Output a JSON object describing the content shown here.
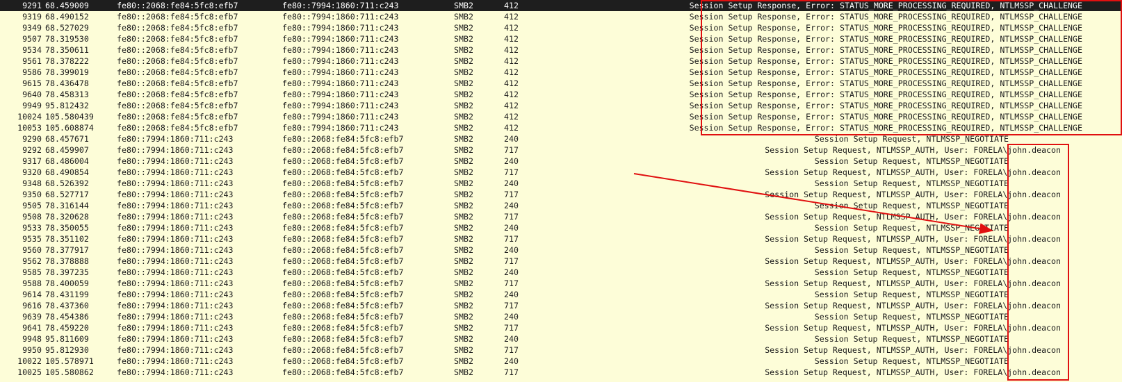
{
  "packets": [
    {
      "no": "9291",
      "time": "68.459009",
      "src": "fe80::2068:fe84:5fc8:efb7",
      "dst": "fe80::7994:1860:711:c243",
      "proto": "SMB2",
      "len": "412",
      "info": "Session Setup Response, Error: STATUS_MORE_PROCESSING_REQUIRED, NTLMSSP_CHALLENGE",
      "kind": "resp",
      "selected": true
    },
    {
      "no": "9319",
      "time": "68.490152",
      "src": "fe80::2068:fe84:5fc8:efb7",
      "dst": "fe80::7994:1860:711:c243",
      "proto": "SMB2",
      "len": "412",
      "info": "Session Setup Response, Error: STATUS_MORE_PROCESSING_REQUIRED, NTLMSSP_CHALLENGE",
      "kind": "resp"
    },
    {
      "no": "9349",
      "time": "68.527029",
      "src": "fe80::2068:fe84:5fc8:efb7",
      "dst": "fe80::7994:1860:711:c243",
      "proto": "SMB2",
      "len": "412",
      "info": "Session Setup Response, Error: STATUS_MORE_PROCESSING_REQUIRED, NTLMSSP_CHALLENGE",
      "kind": "resp"
    },
    {
      "no": "9507",
      "time": "78.319530",
      "src": "fe80::2068:fe84:5fc8:efb7",
      "dst": "fe80::7994:1860:711:c243",
      "proto": "SMB2",
      "len": "412",
      "info": "Session Setup Response, Error: STATUS_MORE_PROCESSING_REQUIRED, NTLMSSP_CHALLENGE",
      "kind": "resp"
    },
    {
      "no": "9534",
      "time": "78.350611",
      "src": "fe80::2068:fe84:5fc8:efb7",
      "dst": "fe80::7994:1860:711:c243",
      "proto": "SMB2",
      "len": "412",
      "info": "Session Setup Response, Error: STATUS_MORE_PROCESSING_REQUIRED, NTLMSSP_CHALLENGE",
      "kind": "resp"
    },
    {
      "no": "9561",
      "time": "78.378222",
      "src": "fe80::2068:fe84:5fc8:efb7",
      "dst": "fe80::7994:1860:711:c243",
      "proto": "SMB2",
      "len": "412",
      "info": "Session Setup Response, Error: STATUS_MORE_PROCESSING_REQUIRED, NTLMSSP_CHALLENGE",
      "kind": "resp"
    },
    {
      "no": "9586",
      "time": "78.399019",
      "src": "fe80::2068:fe84:5fc8:efb7",
      "dst": "fe80::7994:1860:711:c243",
      "proto": "SMB2",
      "len": "412",
      "info": "Session Setup Response, Error: STATUS_MORE_PROCESSING_REQUIRED, NTLMSSP_CHALLENGE",
      "kind": "resp"
    },
    {
      "no": "9615",
      "time": "78.436478",
      "src": "fe80::2068:fe84:5fc8:efb7",
      "dst": "fe80::7994:1860:711:c243",
      "proto": "SMB2",
      "len": "412",
      "info": "Session Setup Response, Error: STATUS_MORE_PROCESSING_REQUIRED, NTLMSSP_CHALLENGE",
      "kind": "resp"
    },
    {
      "no": "9640",
      "time": "78.458313",
      "src": "fe80::2068:fe84:5fc8:efb7",
      "dst": "fe80::7994:1860:711:c243",
      "proto": "SMB2",
      "len": "412",
      "info": "Session Setup Response, Error: STATUS_MORE_PROCESSING_REQUIRED, NTLMSSP_CHALLENGE",
      "kind": "resp"
    },
    {
      "no": "9949",
      "time": "95.812432",
      "src": "fe80::2068:fe84:5fc8:efb7",
      "dst": "fe80::7994:1860:711:c243",
      "proto": "SMB2",
      "len": "412",
      "info": "Session Setup Response, Error: STATUS_MORE_PROCESSING_REQUIRED, NTLMSSP_CHALLENGE",
      "kind": "resp"
    },
    {
      "no": "10024",
      "time": "105.580439",
      "src": "fe80::2068:fe84:5fc8:efb7",
      "dst": "fe80::7994:1860:711:c243",
      "proto": "SMB2",
      "len": "412",
      "info": "Session Setup Response, Error: STATUS_MORE_PROCESSING_REQUIRED, NTLMSSP_CHALLENGE",
      "kind": "resp"
    },
    {
      "no": "10053",
      "time": "105.608874",
      "src": "fe80::2068:fe84:5fc8:efb7",
      "dst": "fe80::7994:1860:711:c243",
      "proto": "SMB2",
      "len": "412",
      "info": "Session Setup Response, Error: STATUS_MORE_PROCESSING_REQUIRED, NTLMSSP_CHALLENGE",
      "kind": "resp"
    },
    {
      "no": "9290",
      "time": "68.457671",
      "src": "fe80::7994:1860:711:c243",
      "dst": "fe80::2068:fe84:5fc8:efb7",
      "proto": "SMB2",
      "len": "240",
      "info": "Session Setup Request, NTLMSSP_NEGOTIATE",
      "kind": "nego"
    },
    {
      "no": "9292",
      "time": "68.459907",
      "src": "fe80::7994:1860:711:c243",
      "dst": "fe80::2068:fe84:5fc8:efb7",
      "proto": "SMB2",
      "len": "717",
      "info": "Session Setup Request, NTLMSSP_AUTH, User: FORELA\\john.deacon",
      "kind": "auth"
    },
    {
      "no": "9317",
      "time": "68.486004",
      "src": "fe80::7994:1860:711:c243",
      "dst": "fe80::2068:fe84:5fc8:efb7",
      "proto": "SMB2",
      "len": "240",
      "info": "Session Setup Request, NTLMSSP_NEGOTIATE",
      "kind": "nego"
    },
    {
      "no": "9320",
      "time": "68.490854",
      "src": "fe80::7994:1860:711:c243",
      "dst": "fe80::2068:fe84:5fc8:efb7",
      "proto": "SMB2",
      "len": "717",
      "info": "Session Setup Request, NTLMSSP_AUTH, User: FORELA\\john.deacon",
      "kind": "auth"
    },
    {
      "no": "9348",
      "time": "68.526392",
      "src": "fe80::7994:1860:711:c243",
      "dst": "fe80::2068:fe84:5fc8:efb7",
      "proto": "SMB2",
      "len": "240",
      "info": "Session Setup Request, NTLMSSP_NEGOTIATE",
      "kind": "nego"
    },
    {
      "no": "9350",
      "time": "68.527717",
      "src": "fe80::7994:1860:711:c243",
      "dst": "fe80::2068:fe84:5fc8:efb7",
      "proto": "SMB2",
      "len": "717",
      "info": "Session Setup Request, NTLMSSP_AUTH, User: FORELA\\john.deacon",
      "kind": "auth"
    },
    {
      "no": "9505",
      "time": "78.316144",
      "src": "fe80::7994:1860:711:c243",
      "dst": "fe80::2068:fe84:5fc8:efb7",
      "proto": "SMB2",
      "len": "240",
      "info": "Session Setup Request, NTLMSSP_NEGOTIATE",
      "kind": "nego"
    },
    {
      "no": "9508",
      "time": "78.320628",
      "src": "fe80::7994:1860:711:c243",
      "dst": "fe80::2068:fe84:5fc8:efb7",
      "proto": "SMB2",
      "len": "717",
      "info": "Session Setup Request, NTLMSSP_AUTH, User: FORELA\\john.deacon",
      "kind": "auth"
    },
    {
      "no": "9533",
      "time": "78.350055",
      "src": "fe80::7994:1860:711:c243",
      "dst": "fe80::2068:fe84:5fc8:efb7",
      "proto": "SMB2",
      "len": "240",
      "info": "Session Setup Request, NTLMSSP_NEGOTIATE",
      "kind": "nego"
    },
    {
      "no": "9535",
      "time": "78.351102",
      "src": "fe80::7994:1860:711:c243",
      "dst": "fe80::2068:fe84:5fc8:efb7",
      "proto": "SMB2",
      "len": "717",
      "info": "Session Setup Request, NTLMSSP_AUTH, User: FORELA\\john.deacon",
      "kind": "auth"
    },
    {
      "no": "9560",
      "time": "78.377917",
      "src": "fe80::7994:1860:711:c243",
      "dst": "fe80::2068:fe84:5fc8:efb7",
      "proto": "SMB2",
      "len": "240",
      "info": "Session Setup Request, NTLMSSP_NEGOTIATE",
      "kind": "nego"
    },
    {
      "no": "9562",
      "time": "78.378888",
      "src": "fe80::7994:1860:711:c243",
      "dst": "fe80::2068:fe84:5fc8:efb7",
      "proto": "SMB2",
      "len": "717",
      "info": "Session Setup Request, NTLMSSP_AUTH, User: FORELA\\john.deacon",
      "kind": "auth"
    },
    {
      "no": "9585",
      "time": "78.397235",
      "src": "fe80::7994:1860:711:c243",
      "dst": "fe80::2068:fe84:5fc8:efb7",
      "proto": "SMB2",
      "len": "240",
      "info": "Session Setup Request, NTLMSSP_NEGOTIATE",
      "kind": "nego"
    },
    {
      "no": "9588",
      "time": "78.400059",
      "src": "fe80::7994:1860:711:c243",
      "dst": "fe80::2068:fe84:5fc8:efb7",
      "proto": "SMB2",
      "len": "717",
      "info": "Session Setup Request, NTLMSSP_AUTH, User: FORELA\\john.deacon",
      "kind": "auth"
    },
    {
      "no": "9614",
      "time": "78.431199",
      "src": "fe80::7994:1860:711:c243",
      "dst": "fe80::2068:fe84:5fc8:efb7",
      "proto": "SMB2",
      "len": "240",
      "info": "Session Setup Request, NTLMSSP_NEGOTIATE",
      "kind": "nego"
    },
    {
      "no": "9616",
      "time": "78.437360",
      "src": "fe80::7994:1860:711:c243",
      "dst": "fe80::2068:fe84:5fc8:efb7",
      "proto": "SMB2",
      "len": "717",
      "info": "Session Setup Request, NTLMSSP_AUTH, User: FORELA\\john.deacon",
      "kind": "auth"
    },
    {
      "no": "9639",
      "time": "78.454386",
      "src": "fe80::7994:1860:711:c243",
      "dst": "fe80::2068:fe84:5fc8:efb7",
      "proto": "SMB2",
      "len": "240",
      "info": "Session Setup Request, NTLMSSP_NEGOTIATE",
      "kind": "nego"
    },
    {
      "no": "9641",
      "time": "78.459220",
      "src": "fe80::7994:1860:711:c243",
      "dst": "fe80::2068:fe84:5fc8:efb7",
      "proto": "SMB2",
      "len": "717",
      "info": "Session Setup Request, NTLMSSP_AUTH, User: FORELA\\john.deacon",
      "kind": "auth"
    },
    {
      "no": "9948",
      "time": "95.811609",
      "src": "fe80::7994:1860:711:c243",
      "dst": "fe80::2068:fe84:5fc8:efb7",
      "proto": "SMB2",
      "len": "240",
      "info": "Session Setup Request, NTLMSSP_NEGOTIATE",
      "kind": "nego"
    },
    {
      "no": "9950",
      "time": "95.812930",
      "src": "fe80::7994:1860:711:c243",
      "dst": "fe80::2068:fe84:5fc8:efb7",
      "proto": "SMB2",
      "len": "717",
      "info": "Session Setup Request, NTLMSSP_AUTH, User: FORELA\\john.deacon",
      "kind": "auth"
    },
    {
      "no": "10022",
      "time": "105.578971",
      "src": "fe80::7994:1860:711:c243",
      "dst": "fe80::2068:fe84:5fc8:efb7",
      "proto": "SMB2",
      "len": "240",
      "info": "Session Setup Request, NTLMSSP_NEGOTIATE",
      "kind": "nego"
    },
    {
      "no": "10025",
      "time": "105.580862",
      "src": "fe80::7994:1860:711:c243",
      "dst": "fe80::2068:fe84:5fc8:efb7",
      "proto": "SMB2",
      "len": "717",
      "info": "Session Setup Request, NTLMSSP_AUTH, User: FORELA\\john.deacon",
      "kind": "auth"
    }
  ],
  "colors": {
    "row_background": "#fdfdd8",
    "selected_background": "#1e1e1e",
    "selected_text": "#ffffff",
    "annotation_red": "#e01010"
  }
}
